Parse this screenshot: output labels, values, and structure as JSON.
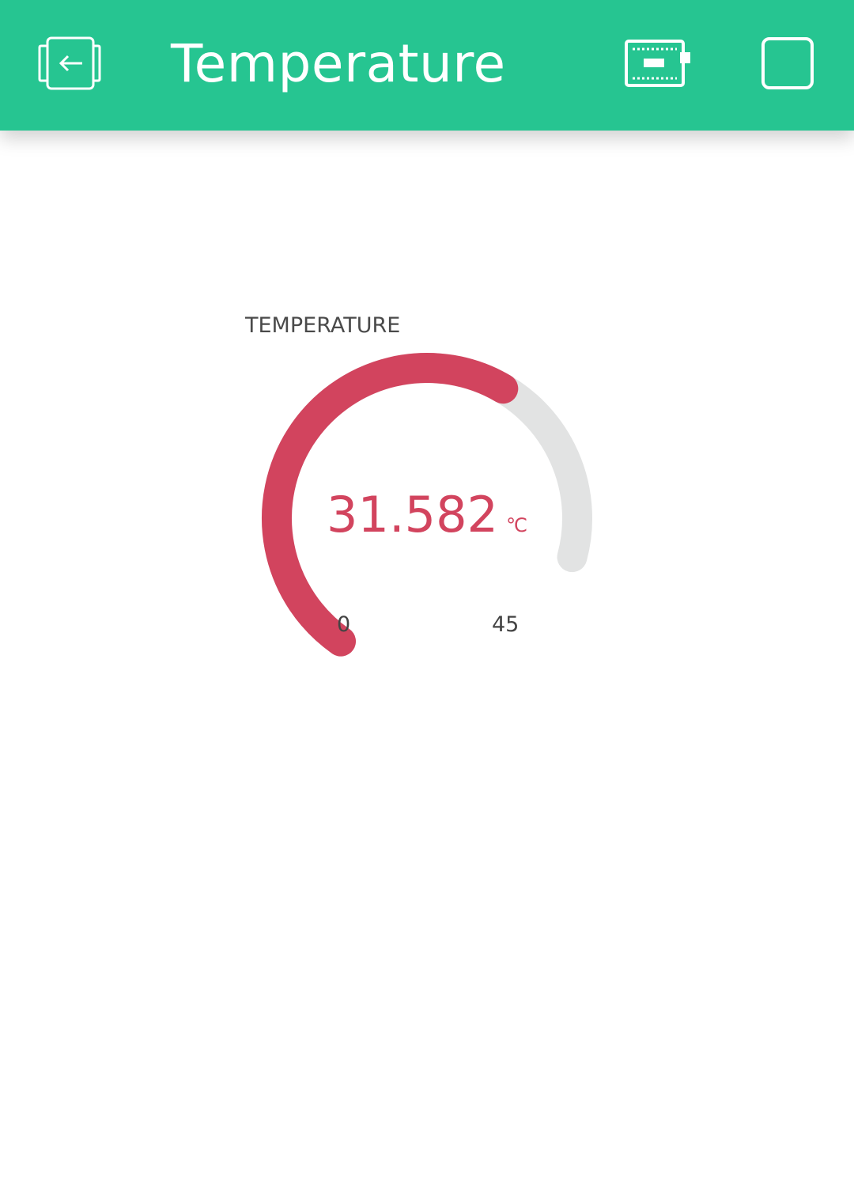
{
  "header": {
    "title": "Temperature",
    "background_color": "#26c591",
    "icons": {
      "back": "exit-dashboard-icon",
      "device": "device-board-icon",
      "stop": "stop-square-icon"
    }
  },
  "gauge": {
    "label": "TEMPERATURE",
    "value": "31.582",
    "unit": "℃",
    "min": "0",
    "max": "45",
    "value_number": 31.582,
    "min_number": 0,
    "max_number": 45,
    "fill_color": "#d2445e",
    "track_color": "#e2e3e3"
  }
}
